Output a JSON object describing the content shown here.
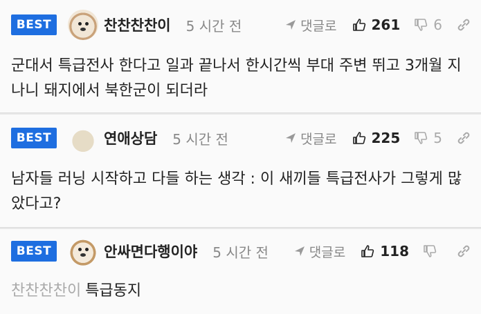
{
  "comments": [
    {
      "badge": "BEST",
      "nickname": "찬찬찬찬이",
      "time": "5 시간 전",
      "reply_label": "댓글로",
      "likes": "261",
      "dislikes": "6",
      "text": "군대서 특급전사 한다고 일과 끝나서 한시간씩 부대 주변 뛰고 3개월 지나니 돼지에서 북한군이 되더라"
    },
    {
      "badge": "BEST",
      "nickname": "연애상담",
      "time": "5 시간 전",
      "reply_label": "댓글로",
      "likes": "225",
      "dislikes": "5",
      "text": "남자들 러닝 시작하고 다들 하는 생각 : 이 새끼들 특급전사가 그렇게 많았다고?"
    },
    {
      "badge": "BEST",
      "nickname": "안싸면다행이야",
      "time": "5 시간 전",
      "reply_label": "댓글로",
      "likes": "118",
      "dislikes": "",
      "mention": "찬찬찬찬이",
      "text": "특급동지"
    }
  ]
}
